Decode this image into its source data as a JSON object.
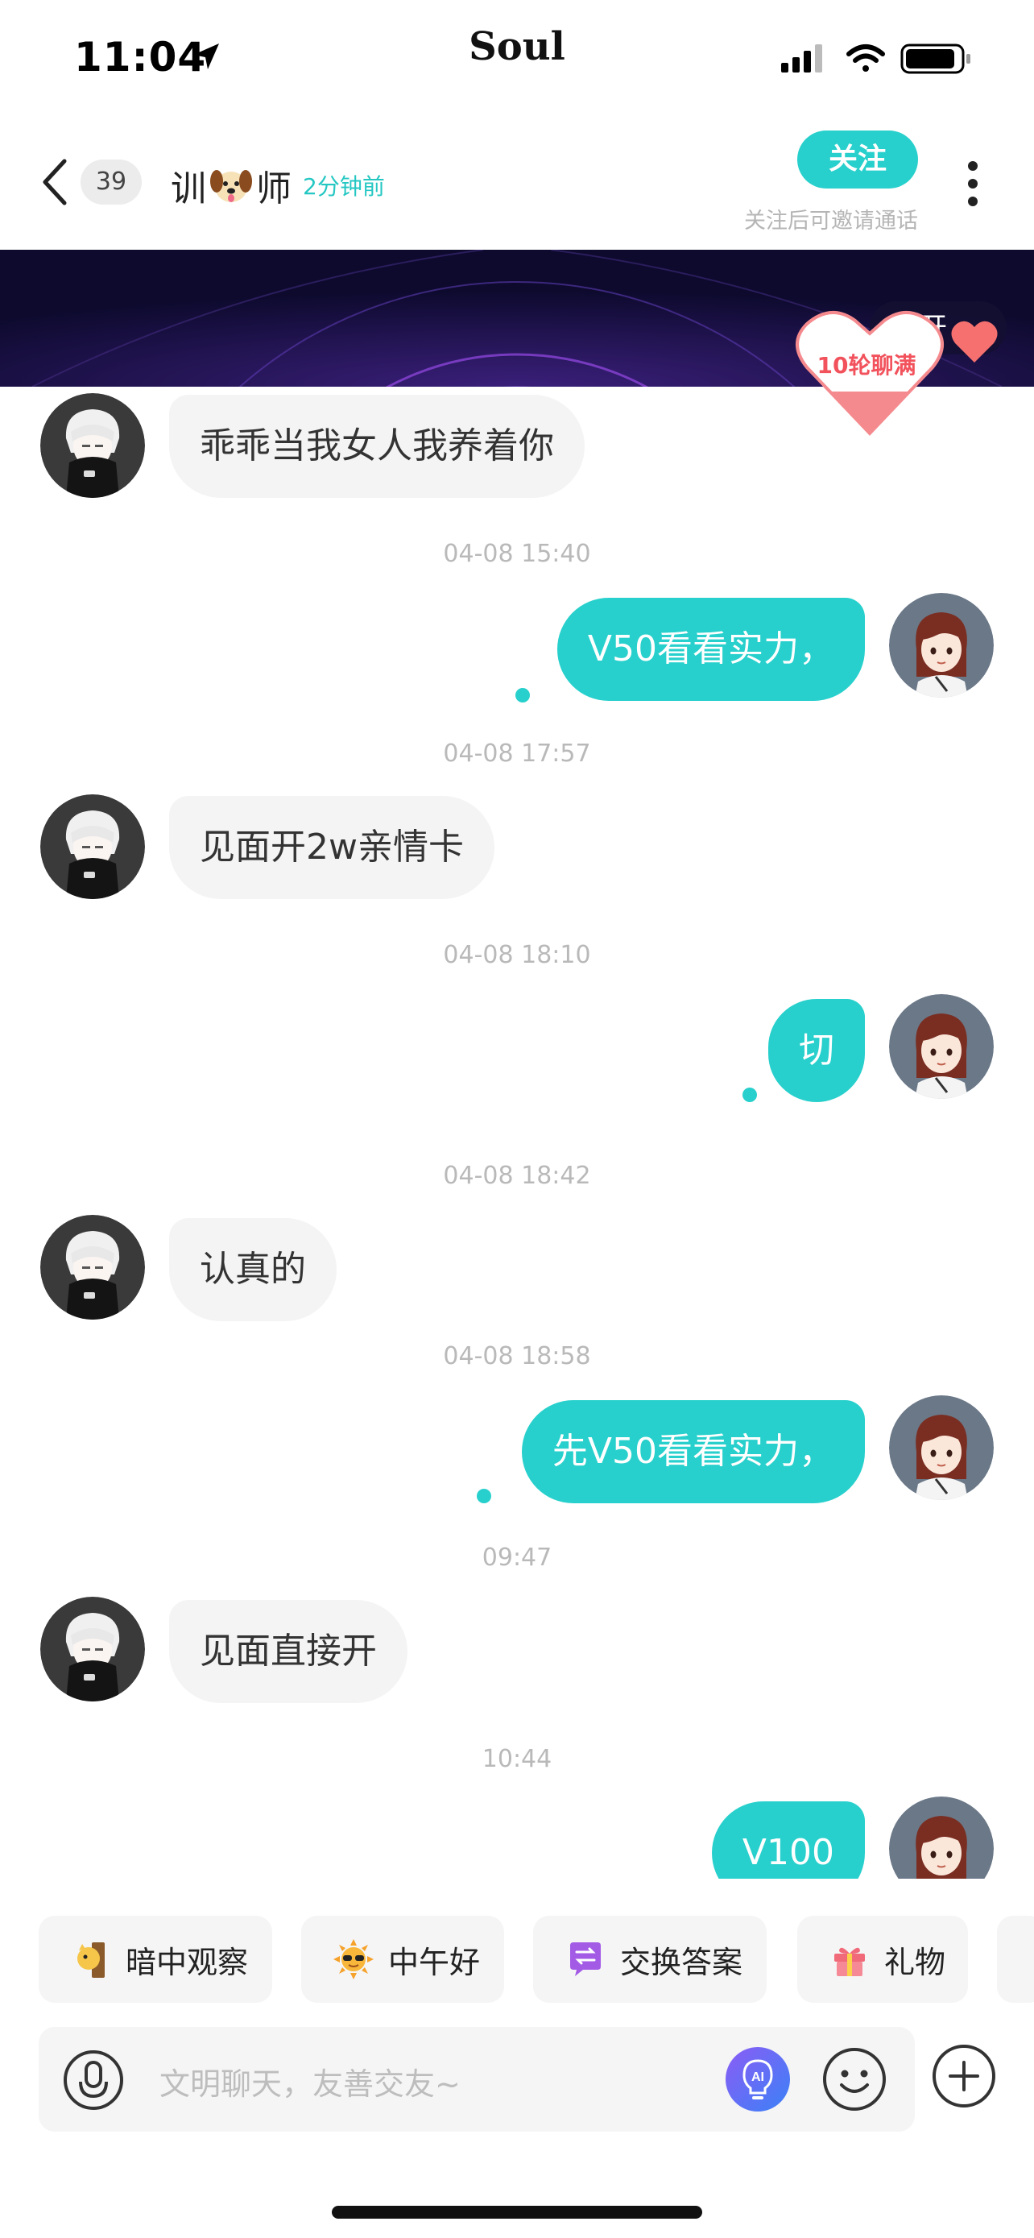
{
  "status_bar": {
    "time": "11:04",
    "brand": "Soul"
  },
  "header": {
    "unread_count": "39",
    "name_prefix": "训",
    "name_suffix": "师",
    "last_active": "2分钟前",
    "follow_label": "关注",
    "follow_hint": "关注后可邀请通话"
  },
  "banner": {
    "expand_label": "展开",
    "heart_label": "10轮聊满"
  },
  "messages": [
    {
      "dir": "in",
      "text": "乖乖当我女人我养着你"
    },
    {
      "timestamp": "04-08 15:40"
    },
    {
      "dir": "out",
      "text": "V50看看实力，"
    },
    {
      "timestamp": "04-08 17:57"
    },
    {
      "dir": "in",
      "text": "见面开2w亲情卡"
    },
    {
      "timestamp": "04-08 18:10"
    },
    {
      "dir": "out",
      "text": "切"
    },
    {
      "timestamp": "04-08 18:42"
    },
    {
      "dir": "in",
      "text": "认真的"
    },
    {
      "timestamp": "04-08 18:58"
    },
    {
      "dir": "out",
      "text": "先V50看看实力，"
    },
    {
      "timestamp": "09:47"
    },
    {
      "dir": "in",
      "text": "见面直接开"
    },
    {
      "timestamp": "10:44"
    },
    {
      "dir": "out",
      "text": "V100"
    }
  ],
  "quick_actions": [
    {
      "label": "暗中观察",
      "icon": "peek-icon"
    },
    {
      "label": "中午好",
      "icon": "sun-sunglasses-icon"
    },
    {
      "label": "交换答案",
      "icon": "exchange-icon"
    },
    {
      "label": "礼物",
      "icon": "gift-icon"
    }
  ],
  "composer": {
    "placeholder": "文明聊天，友善交友~"
  },
  "colors": {
    "accent": "#27d0cc",
    "banner_bg": "#0d0a2e",
    "heart": "#f2525c"
  }
}
